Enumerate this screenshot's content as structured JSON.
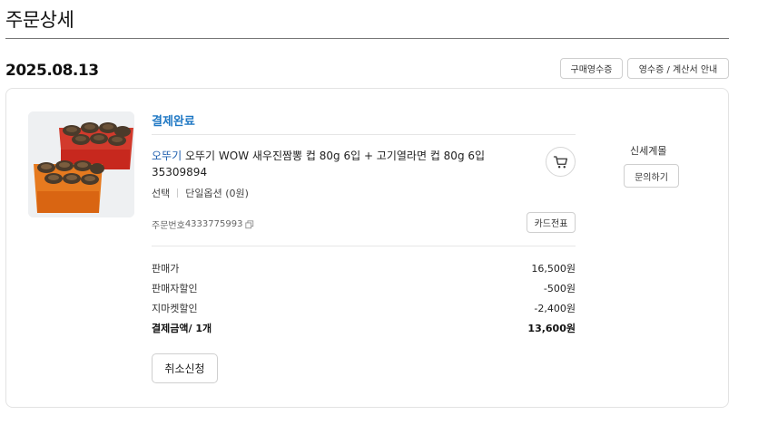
{
  "page": {
    "title": "주문상세"
  },
  "order": {
    "date": "2025.08.13",
    "buttons": {
      "receipt": "구매영수증",
      "tax_invoice": "영수증 / 계산서 안내"
    },
    "status": "결제완료",
    "product": {
      "brand": "오뚜기",
      "name": "오뚜기 WOW 새우진짬뽕 컵 80g 6입 + 고기열라면 컵 80g 6입",
      "code": "35309894",
      "option_label": "선택",
      "option_value": "단일옵션 (0원)",
      "image_icon": "ramen-cups-image"
    },
    "cart_icon": "cart-icon",
    "seller": {
      "name": "신세계몰",
      "inquiry_button": "문의하기"
    },
    "order_number": {
      "label": "주문번호",
      "value": "4333775993",
      "copy_icon": "copy-icon"
    },
    "card_slip_button": "카드전표",
    "price": {
      "rows": [
        {
          "label": "판매가",
          "value": "16,500",
          "unit": "원"
        },
        {
          "label": "판매자할인",
          "value": "-500",
          "unit": "원"
        },
        {
          "label": "지마켓할인",
          "value": "-2,400",
          "unit": "원"
        }
      ],
      "total": {
        "label": "결제금액/ 1개",
        "value": "13,600",
        "unit": "원"
      }
    },
    "cancel_button": "취소신청"
  },
  "colors": {
    "status": "#1f78c4",
    "brand": "#1f5fae"
  }
}
